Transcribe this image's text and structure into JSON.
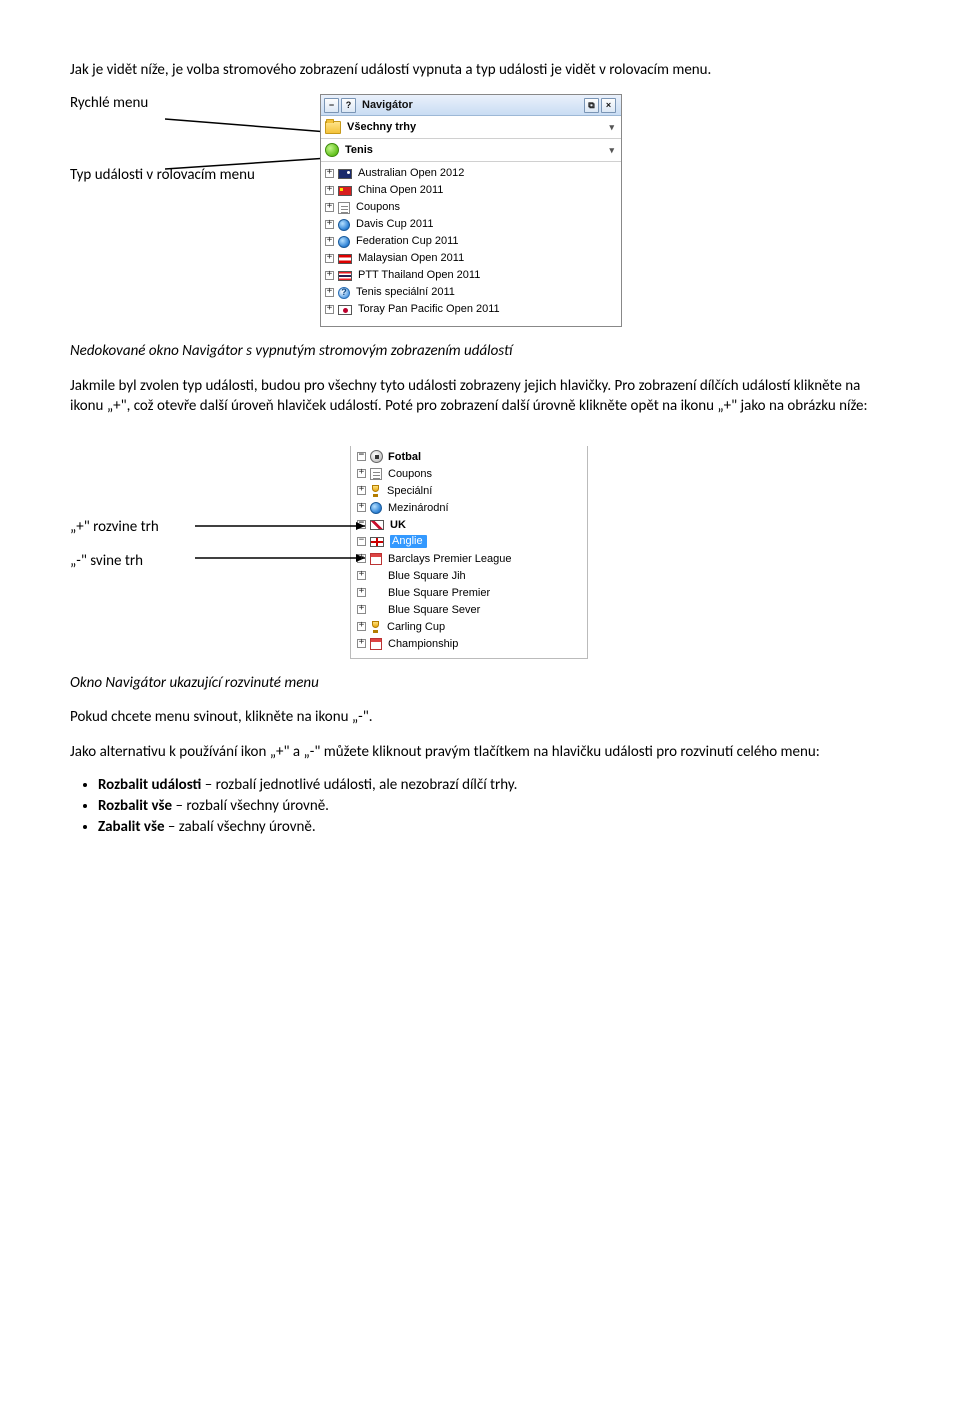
{
  "para1": "Jak je vidět níže, je volba stromového zobrazení událostí vypnuta a typ události je vidět v rolovacím menu.",
  "callout1": {
    "quick_menu": "Rychlé menu",
    "type_menu": "Typ události v rolovacím menu"
  },
  "panel1": {
    "title": "Navigátor",
    "folder": "Všechny trhy",
    "category": "Tenis",
    "items": [
      {
        "icon": "flag-au",
        "label": "Australian Open 2012"
      },
      {
        "icon": "flag-cn",
        "label": "China Open 2011"
      },
      {
        "icon": "doclines",
        "label": "Coupons"
      },
      {
        "icon": "globe",
        "label": "Davis Cup 2011"
      },
      {
        "icon": "globe",
        "label": "Federation Cup 2011"
      },
      {
        "icon": "flag-my",
        "label": "Malaysian Open 2011"
      },
      {
        "icon": "flag-th",
        "label": "PTT Thailand Open 2011"
      },
      {
        "icon": "question",
        "label": "Tenis speciální 2011"
      },
      {
        "icon": "flag-jp",
        "label": "Toray Pan Pacific Open 2011"
      }
    ]
  },
  "caption1": "Nedokované okno Navigátor s vypnutým stromovým zobrazením událostí",
  "para2": "Jakmile byl zvolen typ události, budou pro všechny tyto události zobrazeny jejich hlavičky. Pro zobrazení dílčích událostí klikněte na ikonu „+\", což otevře další úroveň hlaviček událostí. Poté pro zobrazení další úrovně klikněte opět na ikonu „+\" jako na obrázku níže:",
  "callout2": {
    "plus": "„+\" rozvine trh",
    "minus": "„-\" svine trh"
  },
  "panel2": {
    "root": "Fotbal",
    "level1": [
      {
        "box": "plus",
        "icon": "doclines",
        "label": "Coupons"
      },
      {
        "box": "plus",
        "icon": "trophy",
        "label": "Speciální"
      },
      {
        "box": "plus",
        "icon": "globe",
        "label": "Mezinárodní"
      },
      {
        "box": "minus",
        "icon": "flag-uk",
        "label": "UK",
        "bold": true
      }
    ],
    "uk_child": {
      "box": "minus",
      "icon": "flag-en",
      "label": "Anglie",
      "selected": true
    },
    "anglie_children": [
      {
        "icon": "cal",
        "label": "Barclays Premier League"
      },
      {
        "icon": "none",
        "label": "Blue Square Jih"
      },
      {
        "icon": "none",
        "label": "Blue Square Premier"
      },
      {
        "icon": "none",
        "label": "Blue Square Sever"
      },
      {
        "icon": "trophy",
        "label": "Carling Cup"
      },
      {
        "icon": "cal",
        "label": "Championship"
      }
    ]
  },
  "caption2": "Okno Navigátor ukazující rozvinuté menu",
  "para3": "Pokud chcete menu svinout, klikněte na ikonu „-\".",
  "para4": "Jako alternativu k používání ikon „+\" a „-\" můžete kliknout pravým tlačítkem na hlavičku události pro rozvinutí celého menu:",
  "bullets": [
    {
      "b": "Rozbalit události",
      "rest": " – rozbalí jednotlivé události, ale nezobrazí dílčí trhy."
    },
    {
      "b": "Rozbalit vše",
      "rest": " – rozbalí všechny úrovně."
    },
    {
      "b": "Zabalit vše",
      "rest": " – zabalí všechny úrovně."
    }
  ]
}
